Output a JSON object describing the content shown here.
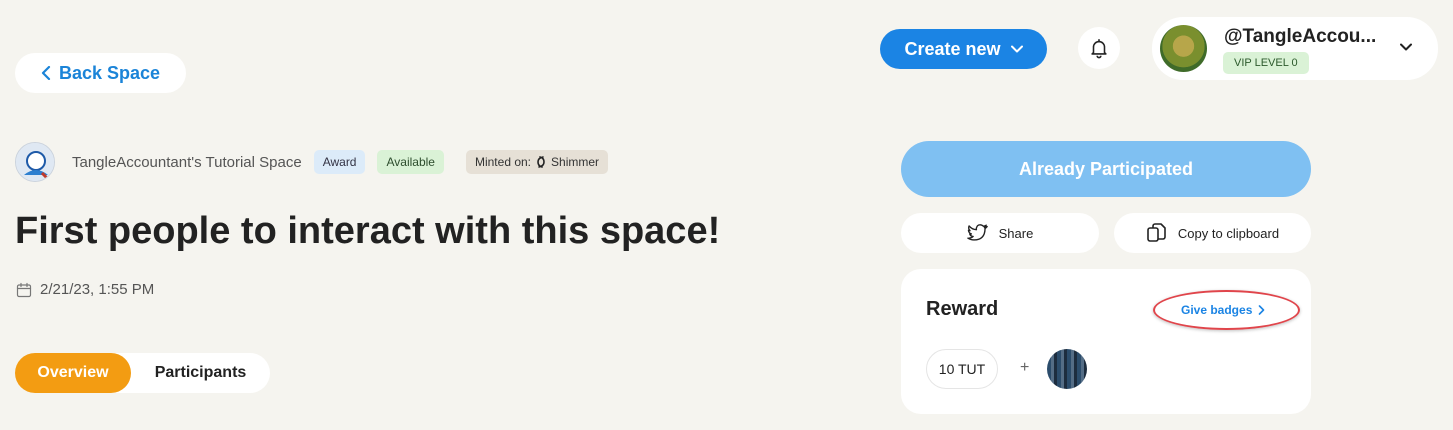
{
  "header": {
    "back_label": "Back Space",
    "create_label": "Create new",
    "user": {
      "name": "@TangleAccou...",
      "vip": "VIP LEVEL 0"
    }
  },
  "space": {
    "name": "TangleAccountant's Tutorial Space",
    "tags": {
      "award": "Award",
      "available": "Available",
      "minted_prefix": "Minted on:",
      "minted_network": "Shimmer"
    }
  },
  "award": {
    "title": "First people to interact with this space!",
    "date": "2/21/23, 1:55 PM"
  },
  "tabs": [
    {
      "label": "Overview",
      "active": true
    },
    {
      "label": "Participants",
      "active": false
    }
  ],
  "actions": {
    "participated_label": "Already Participated",
    "share_label": "Share",
    "copy_label": "Copy to clipboard"
  },
  "reward": {
    "title": "Reward",
    "give_badges_label": "Give badges",
    "token": "10 TUT",
    "plus": "+"
  },
  "colors": {
    "background": "#f5f4ef",
    "primary": "#1b84e4",
    "orange": "#f39c12",
    "participated": "#7fc0f2",
    "highlight": "#e0454b"
  }
}
